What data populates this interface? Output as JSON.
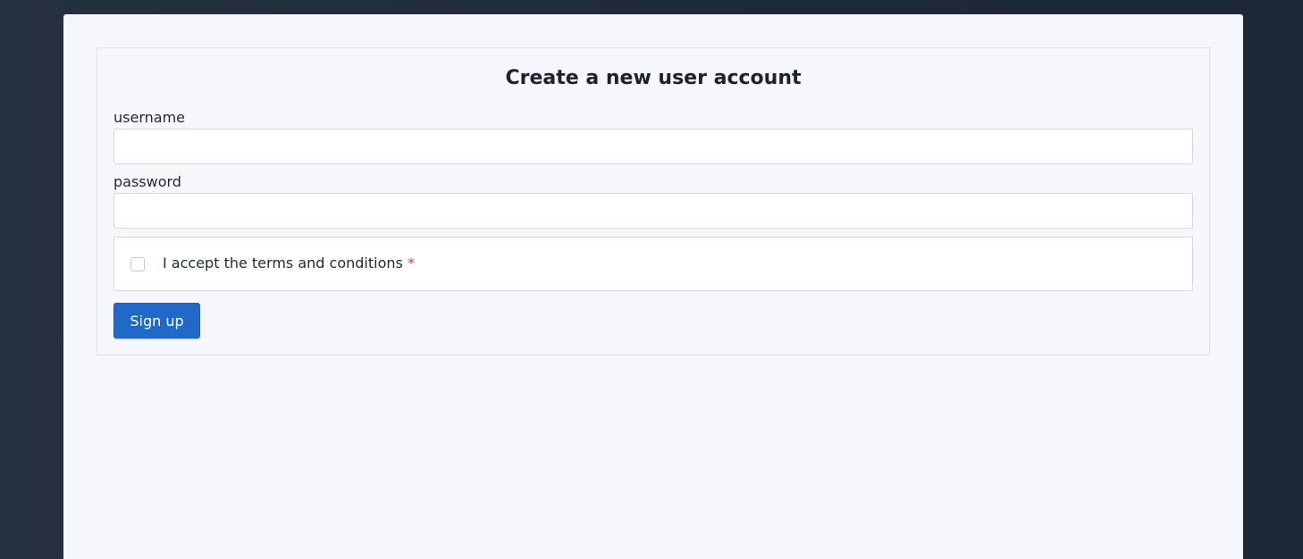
{
  "form": {
    "title": "Create a new user account",
    "username": {
      "label": "username",
      "value": "",
      "placeholder": ""
    },
    "password": {
      "label": "password",
      "value": "",
      "placeholder": ""
    },
    "terms": {
      "label": "I accept the terms and conditions",
      "required_mark": "*",
      "checked": false
    },
    "submit_label": "Sign up"
  },
  "colors": {
    "accent": "#2169c8",
    "required": "#d23b3b",
    "page_background": "#1f2a3b",
    "panel_background": "#f5f7fa"
  }
}
